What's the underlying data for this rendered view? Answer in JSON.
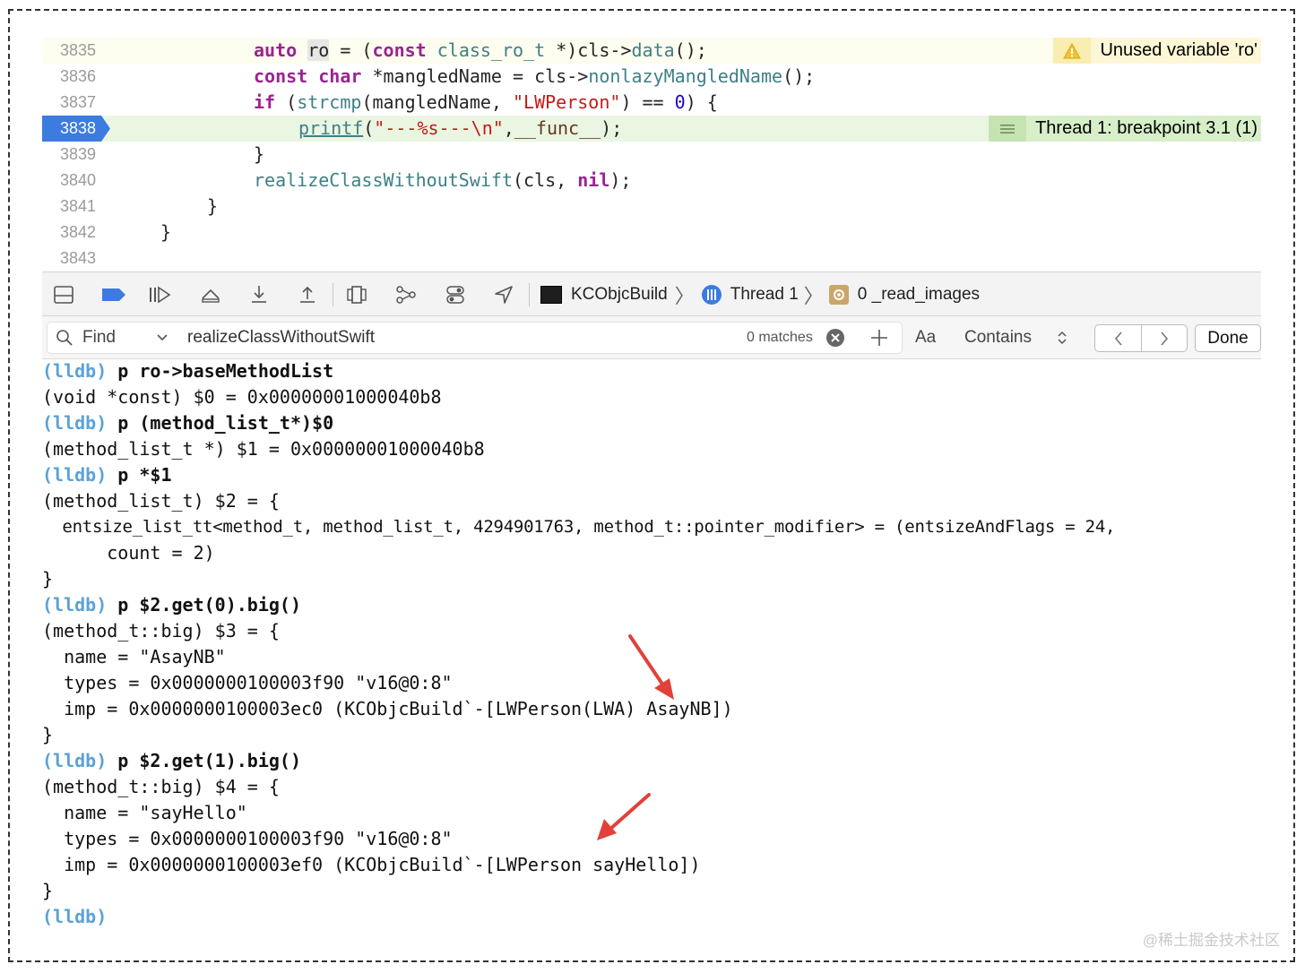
{
  "editor": {
    "lines": [
      {
        "num": "3835",
        "text": "auto ro = (const class_ro_t *)cls->data();"
      },
      {
        "num": "3836",
        "text": "const char *mangledName = cls->nonlazyMangledName();"
      },
      {
        "num": "3837",
        "text": "if (strcmp(mangledName, \"LWPerson\") == 0) {"
      },
      {
        "num": "3838",
        "text": "printf(\"---%s---\\n\",__func__);"
      },
      {
        "num": "3839",
        "text": "}"
      },
      {
        "num": "3840",
        "text": "realizeClassWithoutSwift(cls, nil);"
      },
      {
        "num": "3841",
        "text": "}"
      },
      {
        "num": "3842",
        "text": "}"
      },
      {
        "num": "3843",
        "text": ""
      }
    ],
    "warning_text": "Unused variable 'ro'",
    "breakpoint_text": "Thread 1: breakpoint 3.1 (1)"
  },
  "debugbar": {
    "target": "KCObjcBuild",
    "thread": "Thread 1",
    "frame": "0 _read_images"
  },
  "findbar": {
    "mode": "Find",
    "query": "realizeClassWithoutSwift",
    "matches": "0 matches",
    "case_toggle": "Aa",
    "match_mode": "Contains",
    "done_label": "Done"
  },
  "console": {
    "prompt": "(lldb)",
    "lines": [
      {
        "prompt": "(lldb)",
        "text": " p ro->baseMethodList"
      },
      {
        "text": "(void *const) $0 = 0x00000001000040b8"
      },
      {
        "prompt": "(lldb)",
        "text": " p (method_list_t*)$0"
      },
      {
        "text": "(method_list_t *) $1 = 0x00000001000040b8"
      },
      {
        "prompt": "(lldb)",
        "text": " p *$1"
      },
      {
        "text": "(method_list_t) $2 = {"
      },
      {
        "text": "  entsize_list_tt<method_t, method_list_t, 4294901763, method_t::pointer_modifier> = (entsizeAndFlags = 24,"
      },
      {
        "text": "      count = 2)"
      },
      {
        "text": "}"
      },
      {
        "prompt": "(lldb)",
        "text": " p $2.get(0).big()"
      },
      {
        "text": "(method_t::big) $3 = {"
      },
      {
        "text": "  name = \"AsayNB\""
      },
      {
        "text": "  types = 0x0000000100003f90 \"v16@0:8\""
      },
      {
        "text": "  imp = 0x0000000100003ec0 (KCObjcBuild`-[LWPerson(LWA) AsayNB])"
      },
      {
        "text": "}"
      },
      {
        "prompt": "(lldb)",
        "text": " p $2.get(1).big()"
      },
      {
        "text": "(method_t::big) $4 = {"
      },
      {
        "text": "  name = \"sayHello\""
      },
      {
        "text": "  types = 0x0000000100003f90 \"v16@0:8\""
      },
      {
        "text": "  imp = 0x0000000100003ef0 (KCObjcBuild`-[LWPerson sayHello])"
      },
      {
        "text": "}"
      },
      {
        "prompt": "(lldb)",
        "text": ""
      }
    ]
  },
  "watermark": "@稀土掘金技术社区",
  "colors": {
    "accent": "#3c7be0",
    "prompt": "#5aa2d6",
    "arrow": "#e0413a",
    "keyword": "#9b2393"
  }
}
